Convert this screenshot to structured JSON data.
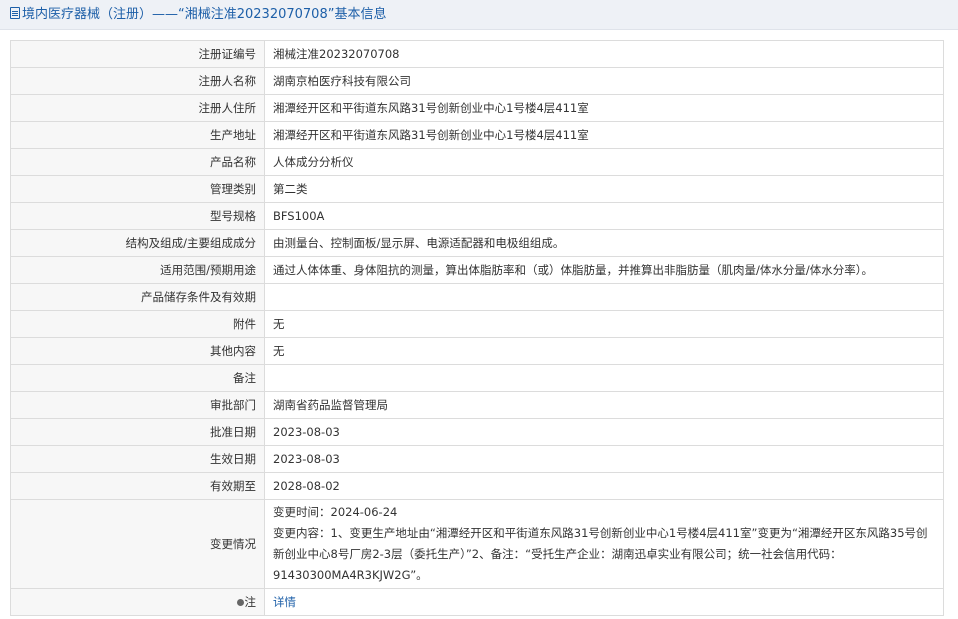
{
  "header": {
    "title": "境内医疗器械（注册）——“湘械注准20232070708”基本信息",
    "title_color": "#1d5fa8"
  },
  "fields": {
    "reg_no": {
      "label": "注册证编号",
      "value": "湘械注准20232070708"
    },
    "registrant_name": {
      "label": "注册人名称",
      "value": "湖南京柏医疗科技有限公司"
    },
    "registrant_address": {
      "label": "注册人住所",
      "value": "湘潭经开区和平街道东风路31号创新创业中心1号楼4层411室"
    },
    "production_address": {
      "label": "生产地址",
      "value": "湘潭经开区和平街道东风路31号创新创业中心1号楼4层411室"
    },
    "product_name": {
      "label": "产品名称",
      "value": "人体成分分析仪"
    },
    "management_class": {
      "label": "管理类别",
      "value": "第二类"
    },
    "model_spec": {
      "label": "型号规格",
      "value": "BFS100A"
    },
    "structure": {
      "label": "结构及组成/主要组成成分",
      "value": "由测量台、控制面板/显示屏、电源适配器和电极组组成。"
    },
    "scope": {
      "label": "适用范围/预期用途",
      "value": "通过人体体重、身体阻抗的测量，算出体脂肪率和（或）体脂肪量，并推算出非脂肪量（肌肉量/体水分量/体水分率）。"
    },
    "storage": {
      "label": "产品储存条件及有效期",
      "value": ""
    },
    "accessories": {
      "label": "附件",
      "value": "无"
    },
    "other": {
      "label": "其他内容",
      "value": "无"
    },
    "remarks": {
      "label": "备注",
      "value": ""
    },
    "approval_dept": {
      "label": "审批部门",
      "value": "湖南省药品监督管理局"
    },
    "approval_date": {
      "label": "批准日期",
      "value": "2023-08-03"
    },
    "effective_date": {
      "label": "生效日期",
      "value": "2023-08-03"
    },
    "expiry_date": {
      "label": "有效期至",
      "value": "2028-08-02"
    },
    "change": {
      "label": "变更情况",
      "time_line": "变更时间：2024-06-24",
      "content_line": "变更内容：1、变更生产地址由“湘潭经开区和平街道东风路31号创新创业中心1号楼4层411室”变更为“湘潭经开区东风路35号创新创业中心8号厂房2-3层（委托生产）”2、备注：“受托生产企业：湖南迅卓实业有限公司；统一社会信用代码：91430300MA4R3KJW2G”。"
    },
    "note": {
      "label": "注",
      "link_text": "详情"
    }
  },
  "colors": {
    "label_bg": "#f7f7f7",
    "border": "#dcdcdc",
    "link": "#1d5fa8"
  }
}
